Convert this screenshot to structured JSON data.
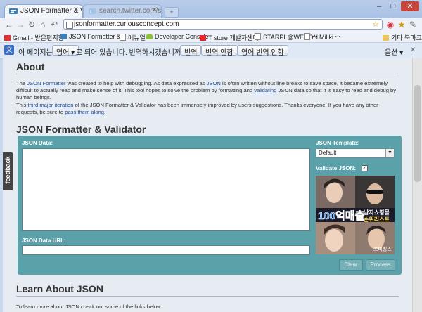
{
  "browser": {
    "tabs": [
      {
        "title": "JSON Formatter & Valid...",
        "active": true
      },
      {
        "title": "search.twitter.com/searc...",
        "active": false
      }
    ],
    "new_tab": "+",
    "window": {
      "minimize": "–",
      "restore": "□",
      "close": "✕"
    },
    "url": "jsonformatter.curiousconcept.com",
    "bookmarks": [
      "Gmail - 받은편지함",
      "JSON Formatter & ...",
      "메뉴얼",
      "Developer Console",
      "T store 개발자센터",
      "STARPL@WECON",
      "::: Millki :::",
      "기타 북마크"
    ],
    "translate_bar": {
      "prefix": "이 페이지는",
      "language": "영어",
      "suffix": "로 되어 있습니다. 번역하시겠습니까?",
      "translate": "번역",
      "no_translate": "번역 안함",
      "never_translate": "영어 번역 안함",
      "options": "옵션",
      "close": "✕"
    }
  },
  "page": {
    "about_title": "About",
    "about_p1": [
      "The ",
      "JSON Formatter",
      " was created to help with debugging. As data expressed as ",
      "JSON",
      " is often written without line breaks to save space, it became extremely difficult to actually read and make sense of it. This tool hopes to solve the problem by formatting and ",
      "validating",
      " JSON data so that it is easy to read and debug by human beings."
    ],
    "about_p2": [
      "This ",
      "third major iteration",
      " of the JSON Formatter & Validator has been immensely improved by users suggestions. Thanks everyone. If you have any other requests, be sure to ",
      "pass them along",
      "."
    ],
    "validator_title": "JSON Formatter & Validator",
    "json_data_label": "JSON Data:",
    "json_data_value": "",
    "json_url_label": "JSON Data URL:",
    "json_url_value": "",
    "template_label": "JSON Template:",
    "template_value": "Default",
    "validate_label": "Validate JSON:",
    "validate_checked": "✓",
    "ad": {
      "headline": "100억매출",
      "subhead": "남자쇼핑몰",
      "subhead2": "순위리스트",
      "brand": "조마칭스"
    },
    "clear_button": "Clear",
    "process_button": "Process",
    "learn_title": "Learn About JSON",
    "learn_p": "To learn more about JSON check out some of the links below.",
    "feedback": "feedback"
  }
}
